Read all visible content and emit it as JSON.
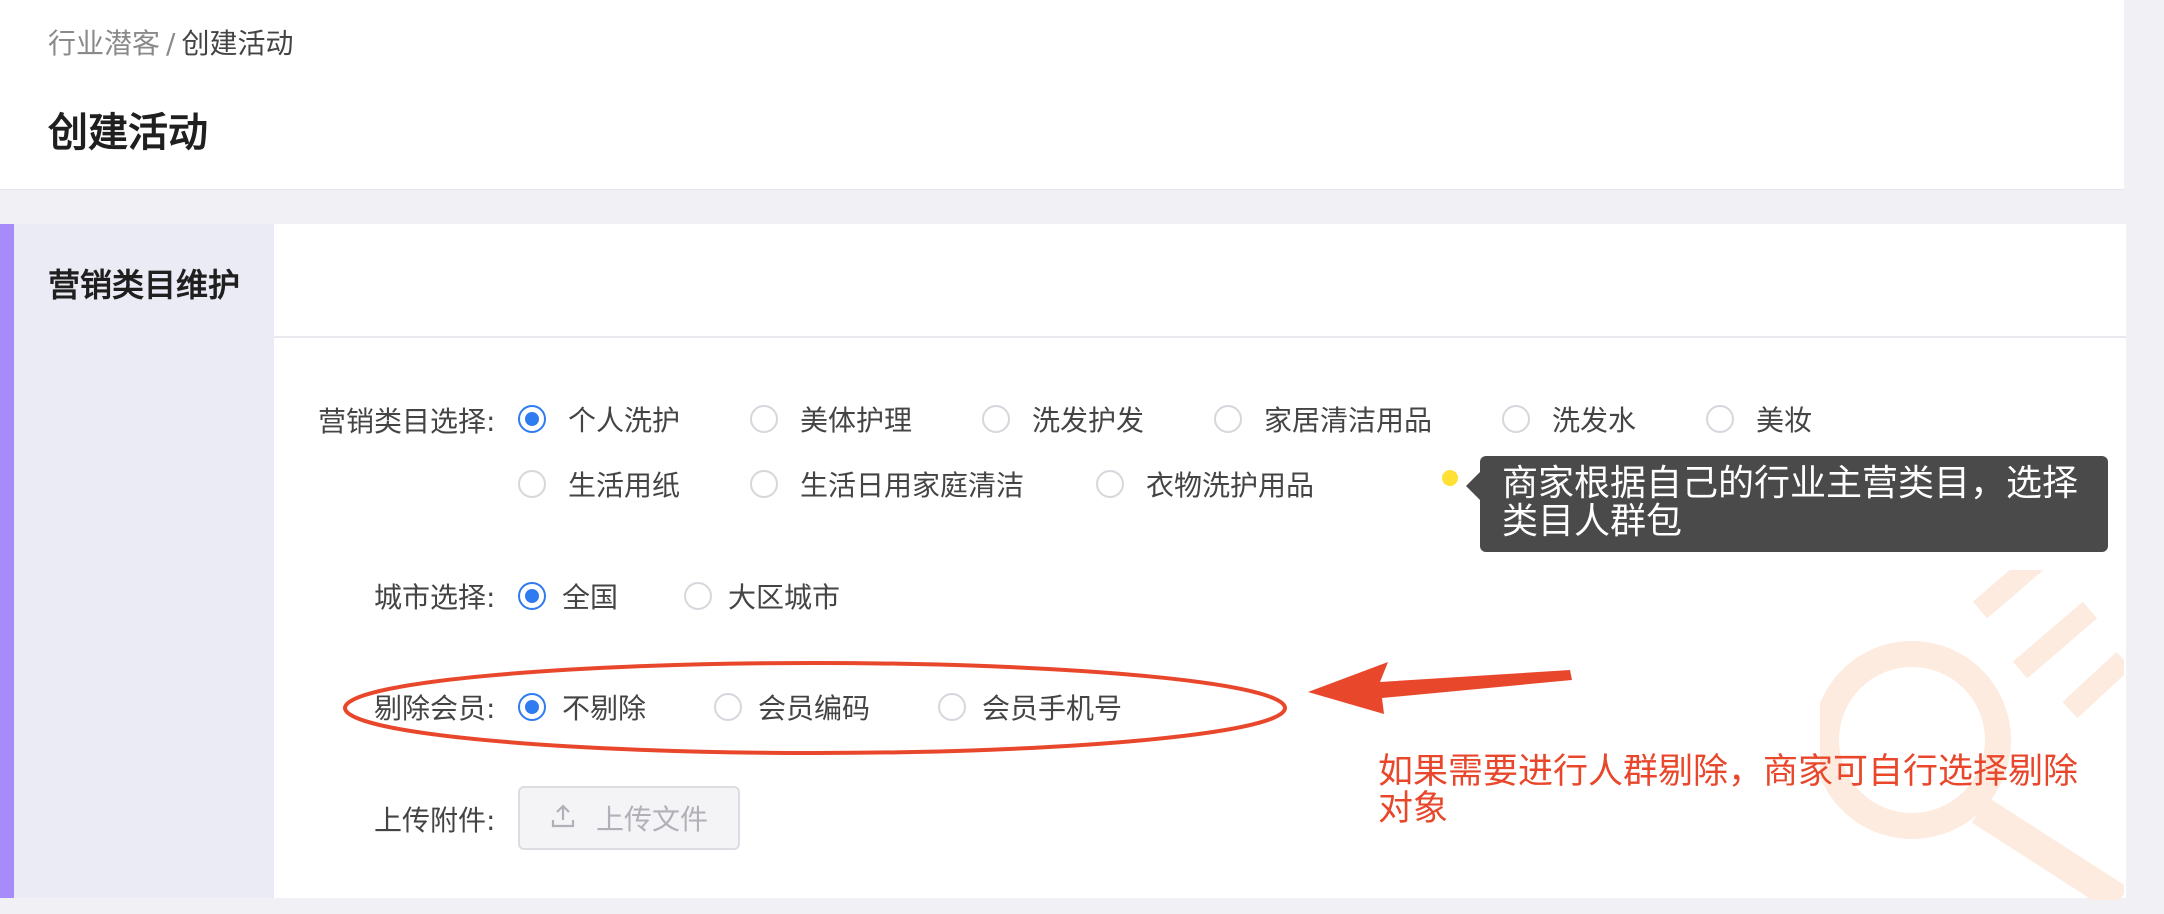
{
  "breadcrumb": {
    "parent": "行业潜客",
    "separator": "/",
    "current": "创建活动"
  },
  "page_title": "创建活动",
  "section": {
    "title": "营销类目维护"
  },
  "category": {
    "label": "营销类目选择:",
    "options": [
      "个人洗护",
      "美体护理",
      "洗发护发",
      "家居清洁用品",
      "洗发水",
      "美妆",
      "生活用纸",
      "生活日用家庭清洁",
      "衣物洗护用品"
    ],
    "selected": "个人洗护"
  },
  "city": {
    "label": "城市选择:",
    "options": [
      "全国",
      "大区城市"
    ],
    "selected": "全国"
  },
  "exclude": {
    "label": "剔除会员:",
    "options": [
      "不剔除",
      "会员编码",
      "会员手机号"
    ],
    "selected": "不剔除"
  },
  "upload": {
    "label": "上传附件:",
    "button": "上传文件"
  },
  "tooltip": {
    "text": "商家根据自己的行业主营类目，选择类目人群包"
  },
  "annotation": {
    "text": "如果需要进行人群剔除，商家可自行选择剔除对象"
  },
  "colors": {
    "accent": "#a78bfa",
    "radio_checked": "#2f7bf0",
    "annotation": "#e8472c",
    "tooltip_bg": "#4a4a4a"
  },
  "icons": {
    "upload": "upload-icon",
    "watermark": "key-watermark-icon"
  }
}
